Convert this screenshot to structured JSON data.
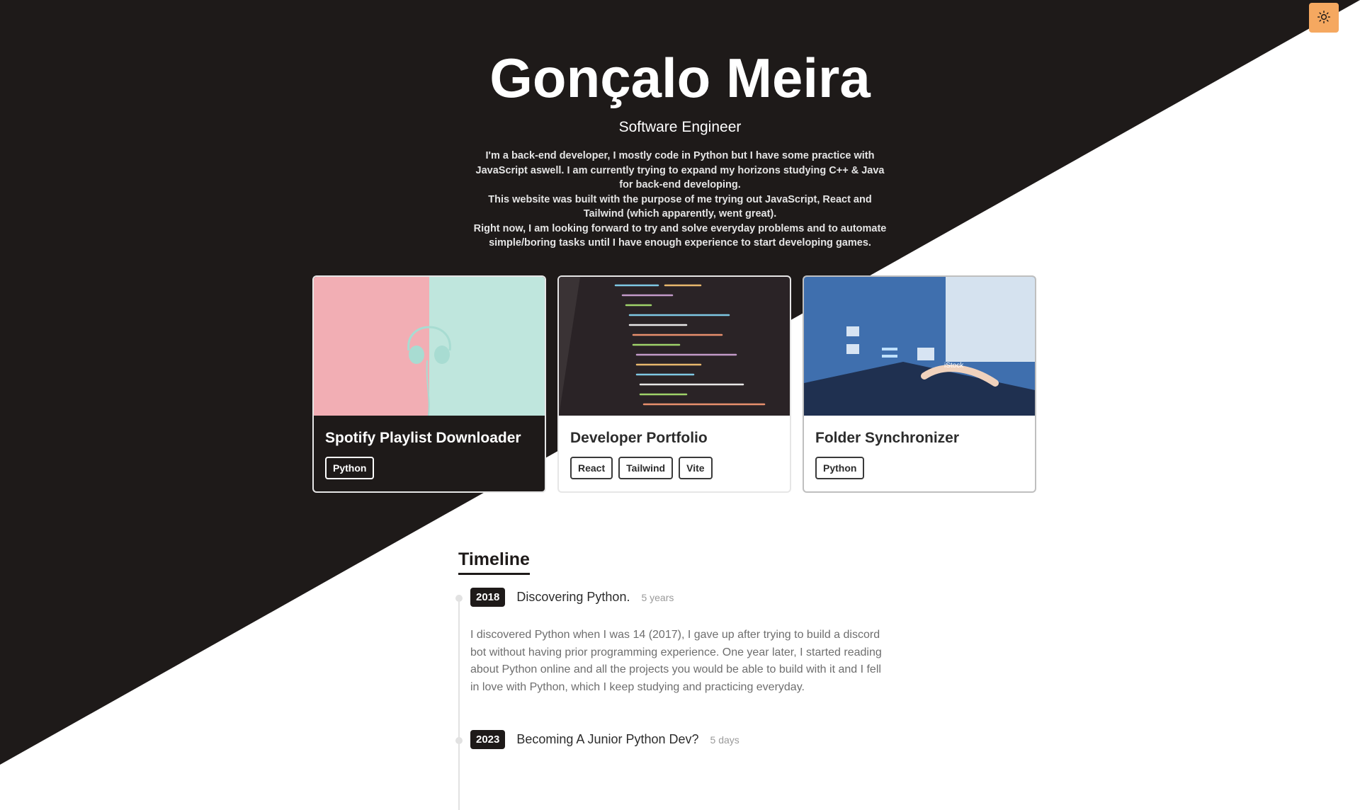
{
  "header": {
    "name": "Gonçalo Meira",
    "role": "Software Engineer",
    "bio": [
      "I'm a back-end developer, I mostly code in Python but I have some practice with JavaScript aswell. I am currently trying to expand my horizons studying C++ & Java for back-end developing.",
      "This website was built with the purpose of me trying out JavaScript, React and Tailwind (which apparently, went great).",
      "Right now, I am looking forward to try and solve everyday problems and to automate simple/boring tasks until I have enough experience to start developing games."
    ]
  },
  "theme_toggle": {
    "icon": "sun-icon"
  },
  "projects": [
    {
      "title": "Spotify Playlist Downloader",
      "tags": [
        "Python"
      ],
      "image": "headphones-on-pink-and-mint"
    },
    {
      "title": "Developer Portfolio",
      "tags": [
        "React",
        "Tailwind",
        "Vite"
      ],
      "image": "code-on-screen"
    },
    {
      "title": "Folder Synchronizer",
      "tags": [
        "Python"
      ],
      "image": "laptop-with-folders",
      "image_watermark": "iStock"
    }
  ],
  "timeline": {
    "heading": "Timeline",
    "items": [
      {
        "year": "2018",
        "title": "Discovering Python.",
        "duration": "5 years",
        "text": "I discovered Python when I was 14 (2017), I gave up after trying to build a discord bot without having prior programming experience. One year later, I started reading about Python online and all the projects you would be able to build with it and I fell in love with Python, which I keep studying and practicing everyday."
      },
      {
        "year": "2023",
        "title": "Becoming A Junior Python Dev?",
        "duration": "5 days"
      }
    ]
  },
  "colors": {
    "dark": "#1e1a19",
    "light": "#ffffff",
    "accent": "#f5a860"
  }
}
